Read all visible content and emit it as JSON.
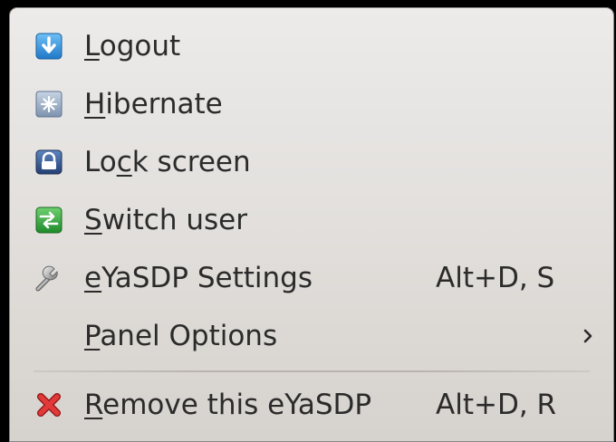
{
  "menu": {
    "items": [
      {
        "mnemonic": "L",
        "rest": "ogout",
        "shortcut": "",
        "icon": "logout-icon"
      },
      {
        "mnemonic": "H",
        "rest": "ibernate",
        "shortcut": "",
        "icon": "hibernate-icon"
      },
      {
        "pre": "Lo",
        "mnemonic": "c",
        "rest": "k screen",
        "shortcut": "",
        "icon": "lock-icon"
      },
      {
        "mnemonic": "S",
        "rest": "witch user",
        "shortcut": "",
        "icon": "switch-user-icon"
      },
      {
        "mnemonic": "e",
        "rest": "YaSDP Settings",
        "shortcut": "Alt+D, S",
        "icon": "wrench-icon"
      },
      {
        "mnemonic": "P",
        "rest": "anel Options",
        "shortcut": "",
        "icon": "chevron-right-icon"
      },
      {
        "mnemonic": "R",
        "rest": "emove this eYaSDP",
        "shortcut": "Alt+D, R",
        "icon": "remove-icon"
      }
    ]
  },
  "colors": {
    "background_top": "#ecebea",
    "background_bottom": "#d6d2cd",
    "text": "#2b2b2b",
    "remove_red": "#d42a2a",
    "logout_blue": "#2f8fd8",
    "switch_green": "#34a63c"
  }
}
